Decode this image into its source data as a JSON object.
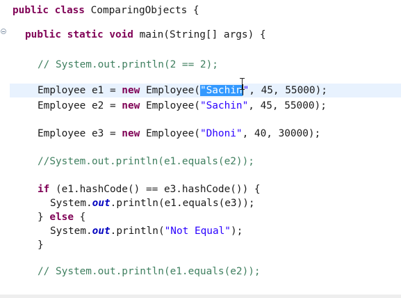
{
  "colors": {
    "keyword": "#7f0055",
    "string": "#2a00ff",
    "comment": "#3f7f5f",
    "static_field": "#0000c0",
    "selection": "#3399ff",
    "current_line": "#e8f2fe"
  },
  "icons": {
    "fold_marker": "collapse-minus-icon",
    "mouse_cursor": "text-cursor-icon"
  },
  "code": {
    "l1": {
      "kw1": "public",
      "kw2": "class",
      "rest": " ComparingObjects {"
    },
    "l2": {
      "kw1": "public",
      "kw2": "static",
      "kw3": "void",
      "rest": " main(String[] args) {"
    },
    "l3": {
      "comment": "// System.out.println(2 == 2);"
    },
    "l4": {
      "pre": "Employee e1 = ",
      "kw": "new",
      "mid": " Employee(",
      "quote_open": "\"",
      "selected": "Sachin",
      "quote_close": "\"",
      "rest": ", 45, 55000);"
    },
    "l5": {
      "pre": "Employee e2 = ",
      "kw": "new",
      "mid": " Employee(",
      "str": "\"Sachin\"",
      "rest": ", 45, 55000);"
    },
    "l6": {
      "pre": "Employee e3 = ",
      "kw": "new",
      "mid": " Employee(",
      "str": "\"Dhoni\"",
      "rest": ", 40, 30000);"
    },
    "l7": {
      "comment": "//System.out.println(e1.equals(e2));"
    },
    "l8": {
      "kw": "if",
      "rest": " (e1.hashCode() == e3.hashCode()) {"
    },
    "l9": {
      "pre": "System.",
      "field": "out",
      "rest": ".println(e1.equals(e3));"
    },
    "l10": {
      "pre": "} ",
      "kw": "else",
      "rest": " {"
    },
    "l11": {
      "pre": "System.",
      "field": "out",
      "mid": ".println(",
      "str": "\"Not Equal\"",
      "rest": ");"
    },
    "l12": {
      "text": "}"
    },
    "l13": {
      "comment": "// System.out.println(e1.equals(e2));"
    }
  }
}
